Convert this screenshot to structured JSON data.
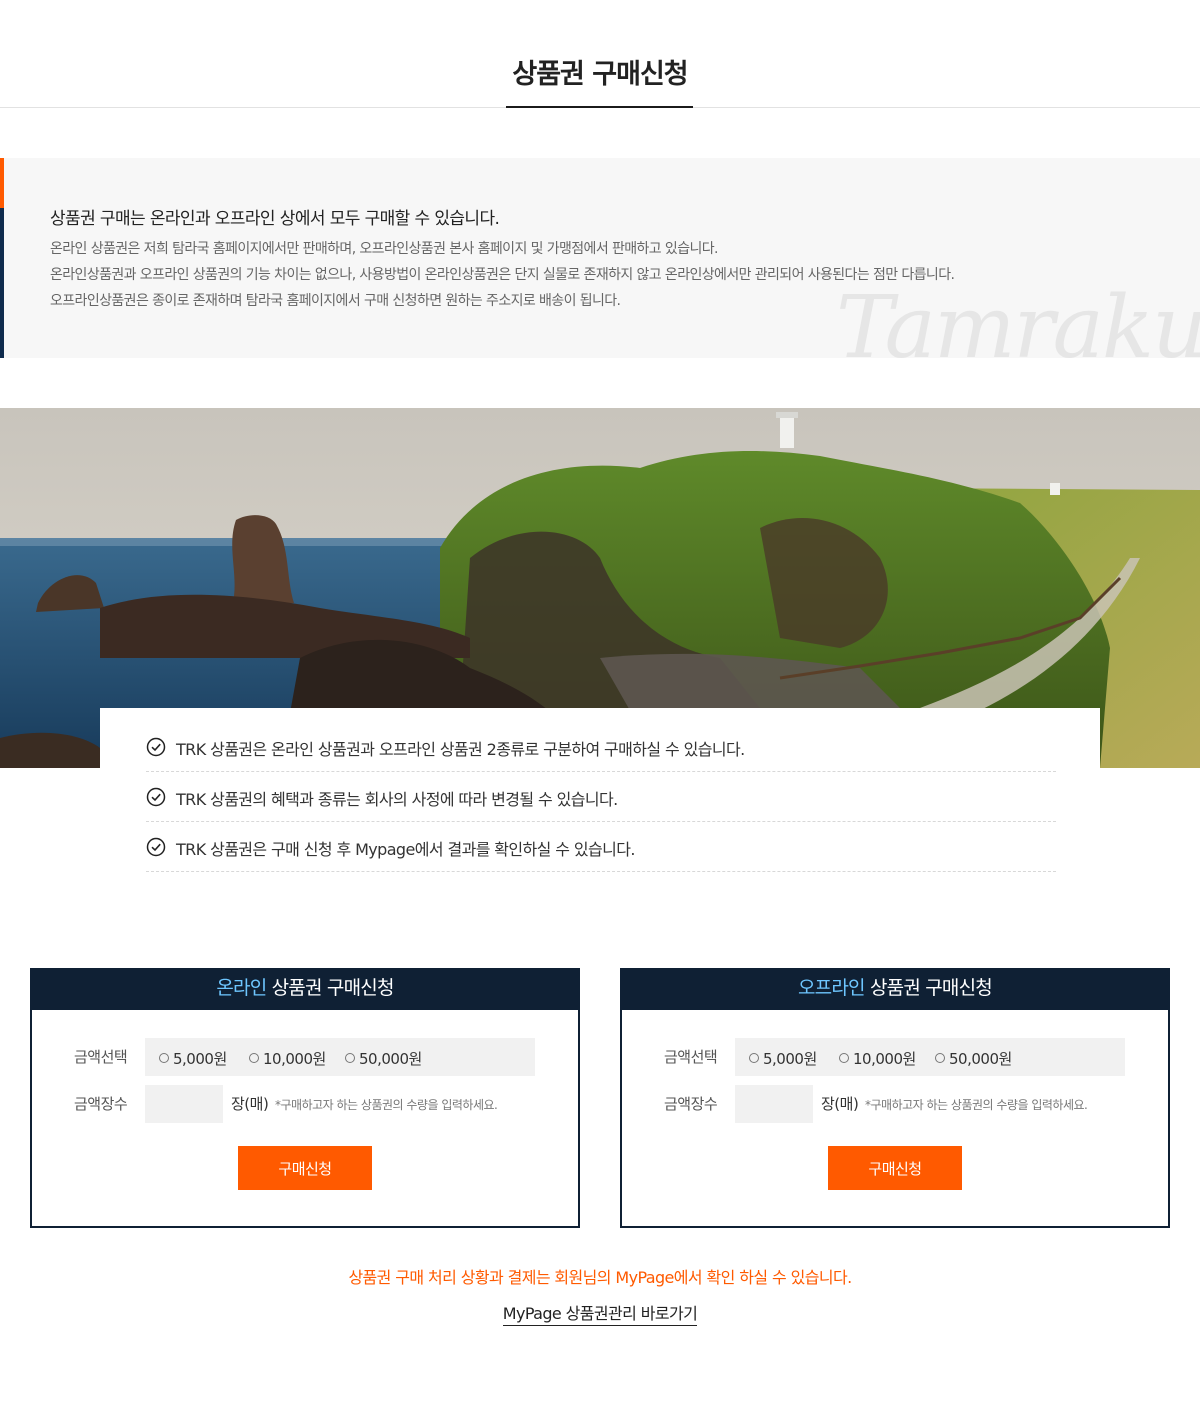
{
  "page": {
    "title": "상품권 구매신청"
  },
  "intro": {
    "heading": "상품권 구매는 온라인과 오프라인 상에서 모두 구매할 수 있습니다.",
    "lines": [
      "온라인 상품권은 저희 탐라국 홈페이지에서만 판매하며, 오프라인상품권 본사 홈페이지 및 가맹점에서 판매하고 있습니다.",
      "온라인상품권과 오프라인 상품권의 기능 차이는 없으나, 사용방법이 온라인상품권은 단지 실물로 존재하지 않고 온라인상에서만 관리되어 사용된다는 점만 다릅니다.",
      "오프라인상품권은 종이로 존재하며 탐라국 홈페이지에서 구매 신청하면 원하는 주소지로 배송이 됩니다."
    ],
    "watermark": "Tamrakuk"
  },
  "notices": [
    "TRK 상품권은 온라인 상품권과 오프라인 상품권 2종류로 구분하여 구매하실 수 있습니다.",
    "TRK 상품권의 혜택과 종류는 회사의 사정에 따라 변경될 수 있습니다.",
    "TRK 상품권은 구매 신청 후 Mypage에서 결과를 확인하실 수 있습니다."
  ],
  "panels": {
    "online": {
      "title_accent": "온라인",
      "title_rest": " 상품권 구매신청",
      "amount_label": "금액선택",
      "options": [
        "5,000원",
        "10,000원",
        "50,000원"
      ],
      "qty_label": "금액장수",
      "qty_value": "",
      "qty_unit": "장(매)",
      "qty_hint": "*구매하고자 하는 상품권의 수량을 입력하세요.",
      "button": "구매신청"
    },
    "offline": {
      "title_accent": "오프라인",
      "title_rest": " 상품권 구매신청",
      "amount_label": "금액선택",
      "options": [
        "5,000원",
        "10,000원",
        "50,000원"
      ],
      "qty_label": "금액장수",
      "qty_value": "",
      "qty_unit": "장(매)",
      "qty_hint": "*구매하고자 하는 상품권의 수량을 입력하세요.",
      "button": "구매신청"
    }
  },
  "footer": {
    "note": "상품권 구매 처리 상황과 결제는 회원님의 MyPage에서 확인 하실 수 있습니다.",
    "link": "MyPage 상품권관리 바로가기"
  },
  "colors": {
    "accent_orange": "#ff5a00",
    "navy": "#0f2034",
    "panel_title_accent": "#6ec6ff"
  }
}
